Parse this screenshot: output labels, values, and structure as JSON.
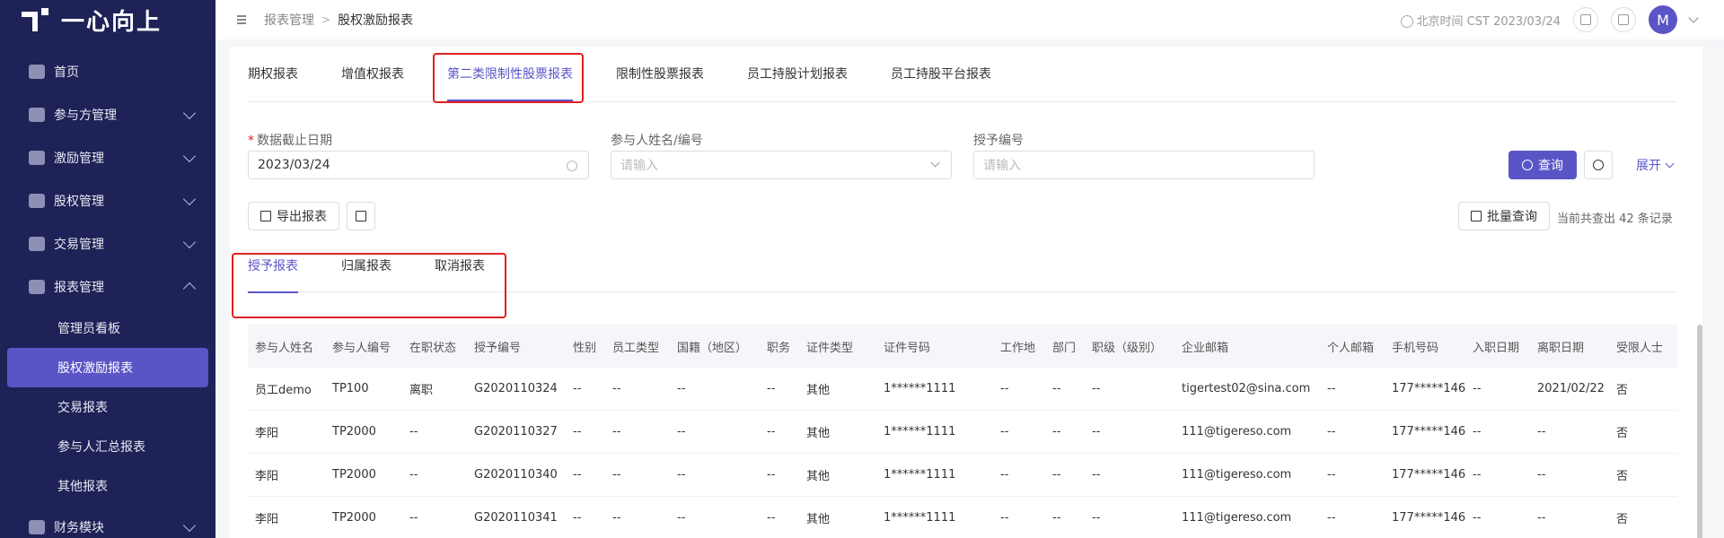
{
  "app": {
    "logo_text": "一心向上"
  },
  "sidebar": {
    "items": [
      {
        "label": "首页",
        "icon": "home-icon"
      },
      {
        "label": "参与方管理",
        "icon": "participant-icon"
      },
      {
        "label": "激励管理",
        "icon": "incentive-icon"
      },
      {
        "label": "股权管理",
        "icon": "equity-icon"
      },
      {
        "label": "交易管理",
        "icon": "trade-icon"
      },
      {
        "label": "报表管理",
        "icon": "report-icon"
      },
      {
        "label": "财务模块",
        "icon": "finance-icon"
      }
    ],
    "report_sub": [
      "管理员看板",
      "股权激励报表",
      "交易报表",
      "参与人汇总报表",
      "其他报表"
    ]
  },
  "header": {
    "breadcrumb": [
      "报表管理",
      "股权激励报表"
    ],
    "time": "北京时间 CST 2023/03/24",
    "avatar": "M"
  },
  "tabs": [
    "期权报表",
    "增值权报表",
    "第二类限制性股票报表",
    "限制性股票报表",
    "员工持股计划报表",
    "员工持股平台报表"
  ],
  "filters": {
    "date_label": "数据截止日期",
    "date_value": "2023/03/24",
    "name_label": "参与人姓名/编号",
    "name_placeholder": "请输入",
    "grant_label": "授予编号",
    "grant_placeholder": "请输入"
  },
  "actions": {
    "query": "查询",
    "expand": "展开",
    "export": "导出报表",
    "batch": "批量查询",
    "count": "当前共查出 42 条记录"
  },
  "sub_tabs": [
    "授予报表",
    "归属报表",
    "取消报表"
  ],
  "table": {
    "headers": [
      "参与人姓名",
      "参与人编号",
      "在职状态",
      "授予编号",
      "性别",
      "员工类型",
      "国籍（地区）",
      "职务",
      "证件类型",
      "证件号码",
      "工作地",
      "部门",
      "职级（级别）",
      "企业邮箱",
      "个人邮箱",
      "手机号码",
      "入职日期",
      "离职日期",
      "受限人士"
    ],
    "rows": [
      [
        "员工demo",
        "TP100",
        "离职",
        "G2020110324",
        "--",
        "--",
        "--",
        "--",
        "其他",
        "1******1111",
        "--",
        "--",
        "--",
        "tigertest02@sina.com",
        "--",
        "177*****146",
        "--",
        "2021/02/22",
        "否"
      ],
      [
        "李阳",
        "TP2000",
        "--",
        "G2020110327",
        "--",
        "--",
        "--",
        "--",
        "其他",
        "1******1111",
        "--",
        "--",
        "--",
        "111@tigereso.com",
        "--",
        "177*****146",
        "--",
        "--",
        "否"
      ],
      [
        "李阳",
        "TP2000",
        "--",
        "G2020110340",
        "--",
        "--",
        "--",
        "--",
        "其他",
        "1******1111",
        "--",
        "--",
        "--",
        "111@tigereso.com",
        "--",
        "177*****146",
        "--",
        "--",
        "否"
      ],
      [
        "李阳",
        "TP2000",
        "--",
        "G2020110341",
        "--",
        "--",
        "--",
        "--",
        "其他",
        "1******1111",
        "--",
        "--",
        "--",
        "111@tigereso.com",
        "--",
        "177*****146",
        "--",
        "--",
        "否"
      ]
    ]
  },
  "colors": {
    "accent": "#5a55c6",
    "sidebar_bg": "#1e2257",
    "highlight": "#e02020"
  }
}
